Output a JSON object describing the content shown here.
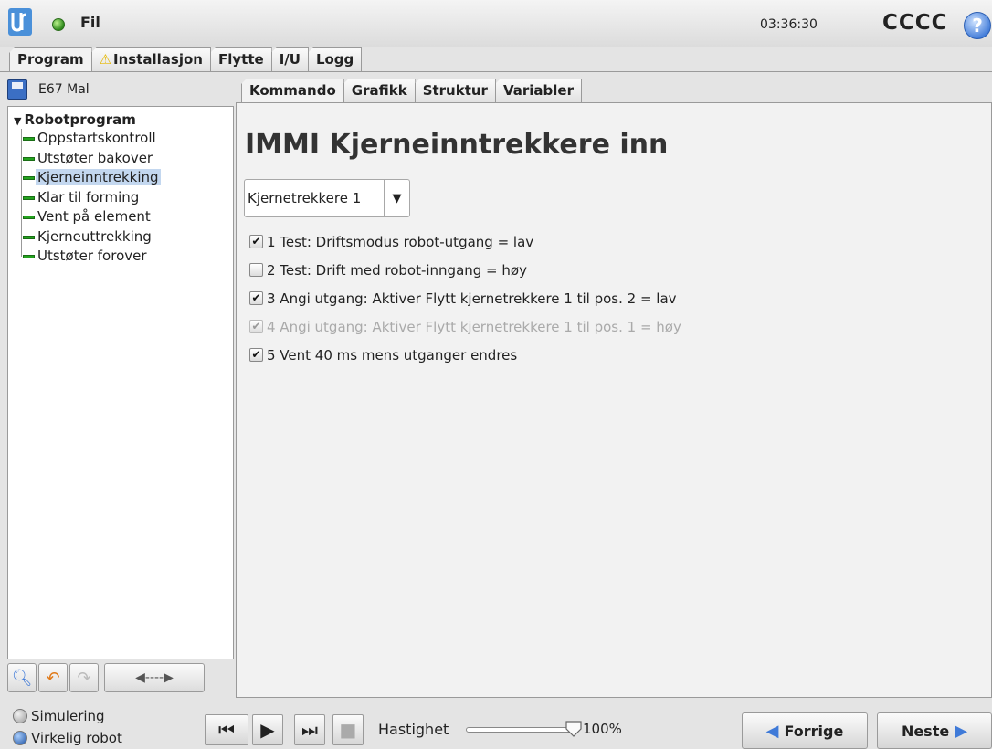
{
  "topbar": {
    "file_label": "Fil",
    "clock": "03:36:30",
    "robot_name": "CCCC",
    "help": "?"
  },
  "main_tabs": [
    "Program",
    "Installasjon",
    "Flytte",
    "I/U",
    "Logg"
  ],
  "program": {
    "name": "E67 Mal"
  },
  "tree": {
    "root": "Robotprogram",
    "items": [
      "Oppstartskontroll",
      "Utstøter bakover",
      "Kjerneinntrekking",
      "Klar til forming",
      "Vent på element",
      "Kjerneuttrekking",
      "Utstøter forover"
    ],
    "selected_index": 2
  },
  "sub_tabs": [
    "Kommando",
    "Grafikk",
    "Struktur",
    "Variabler"
  ],
  "page_title": "IMMI Kjerneinntrekkere inn",
  "dropdown": {
    "value": "Kjernetrekkere 1"
  },
  "checklist": [
    {
      "label": "1 Test: Driftsmodus robot-utgang = lav",
      "checked": true,
      "enabled": true
    },
    {
      "label": "2 Test: Drift med robot-inngang = høy",
      "checked": false,
      "enabled": true
    },
    {
      "label": "3 Angi utgang: Aktiver Flytt kjernetrekkere 1 til pos. 2 = lav",
      "checked": true,
      "enabled": true
    },
    {
      "label": "4 Angi utgang: Aktiver Flytt kjernetrekkere 1 til pos. 1 = høy",
      "checked": true,
      "enabled": false
    },
    {
      "label": "5 Vent 40 ms mens utganger endres",
      "checked": true,
      "enabled": true
    }
  ],
  "bottom": {
    "mode_sim": "Simulering",
    "mode_real": "Virkelig robot",
    "speed_label": "Hastighet",
    "speed_value": "100%",
    "prev": "Forrige",
    "next": "Neste"
  },
  "colors": {
    "accent": "#3f7ad8",
    "node": "#23a31e",
    "selection": "#c3d7ef"
  }
}
